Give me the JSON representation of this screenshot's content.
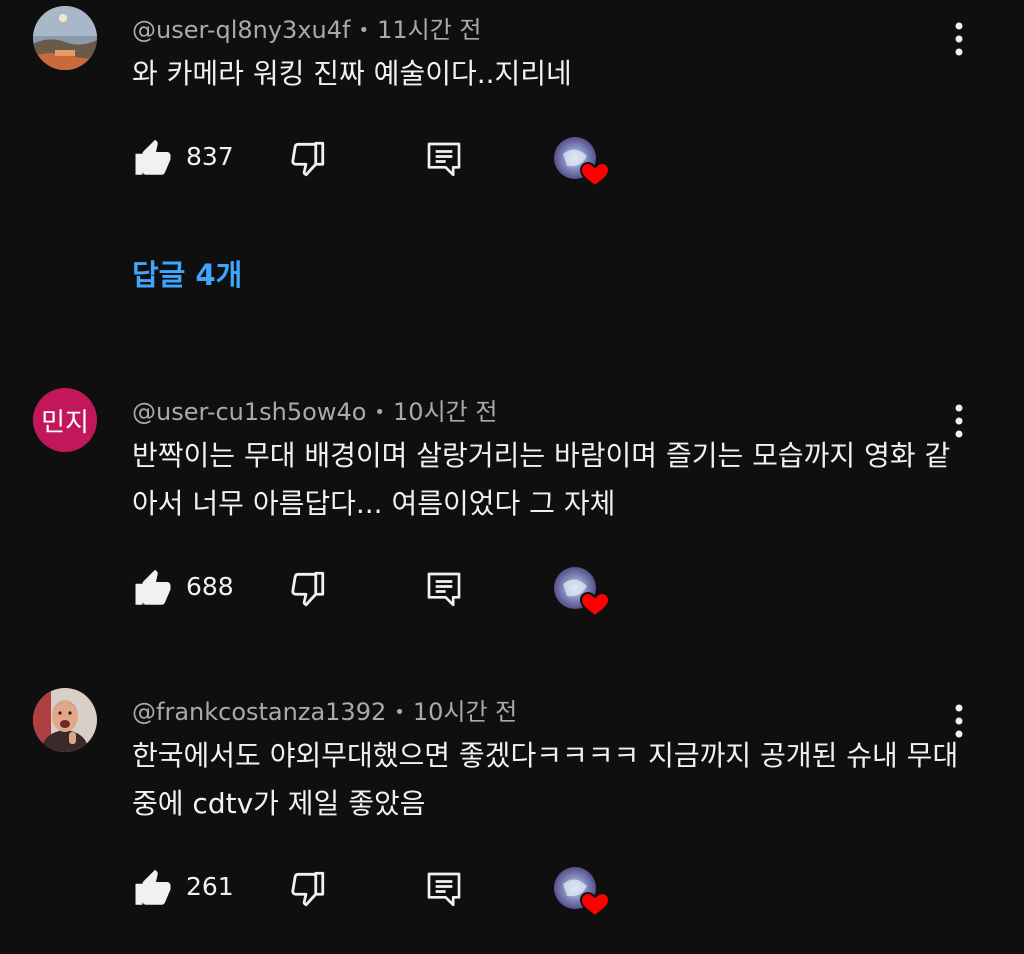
{
  "comments": [
    {
      "handle": "@user-ql8ny3xu4f",
      "time": "11시간 전",
      "text": "와 카메라 워킹 진짜 예술이다..지리네",
      "likes": "837",
      "avatar_icon": "landscape-avatar",
      "replies_label": "답글 4개"
    },
    {
      "handle": "@user-cu1sh5ow4o",
      "time": "10시간 전",
      "text": "반짝이는 무대 배경이며 살랑거리는 바람이며 즐기는 모습까지 영화 같아서 너무 아름답다... 여름이었다 그 자체",
      "likes": "688",
      "avatar_text": "민지",
      "avatar_color": "#c2185b"
    },
    {
      "handle": "@frankcostanza1392",
      "time": "10시간 전",
      "text": "한국에서도 야외무대했으면 좋겠다ㅋㅋㅋㅋ 지금까지 공개된 슈내 무대중에 cdtv가 제일 좋았음",
      "likes": "261",
      "avatar_icon": "person-photo-avatar"
    }
  ],
  "colors": {
    "background": "#0f0f0f",
    "link": "#3ea6ff",
    "heart": "#ff0000",
    "meta": "#aaaaaa"
  }
}
